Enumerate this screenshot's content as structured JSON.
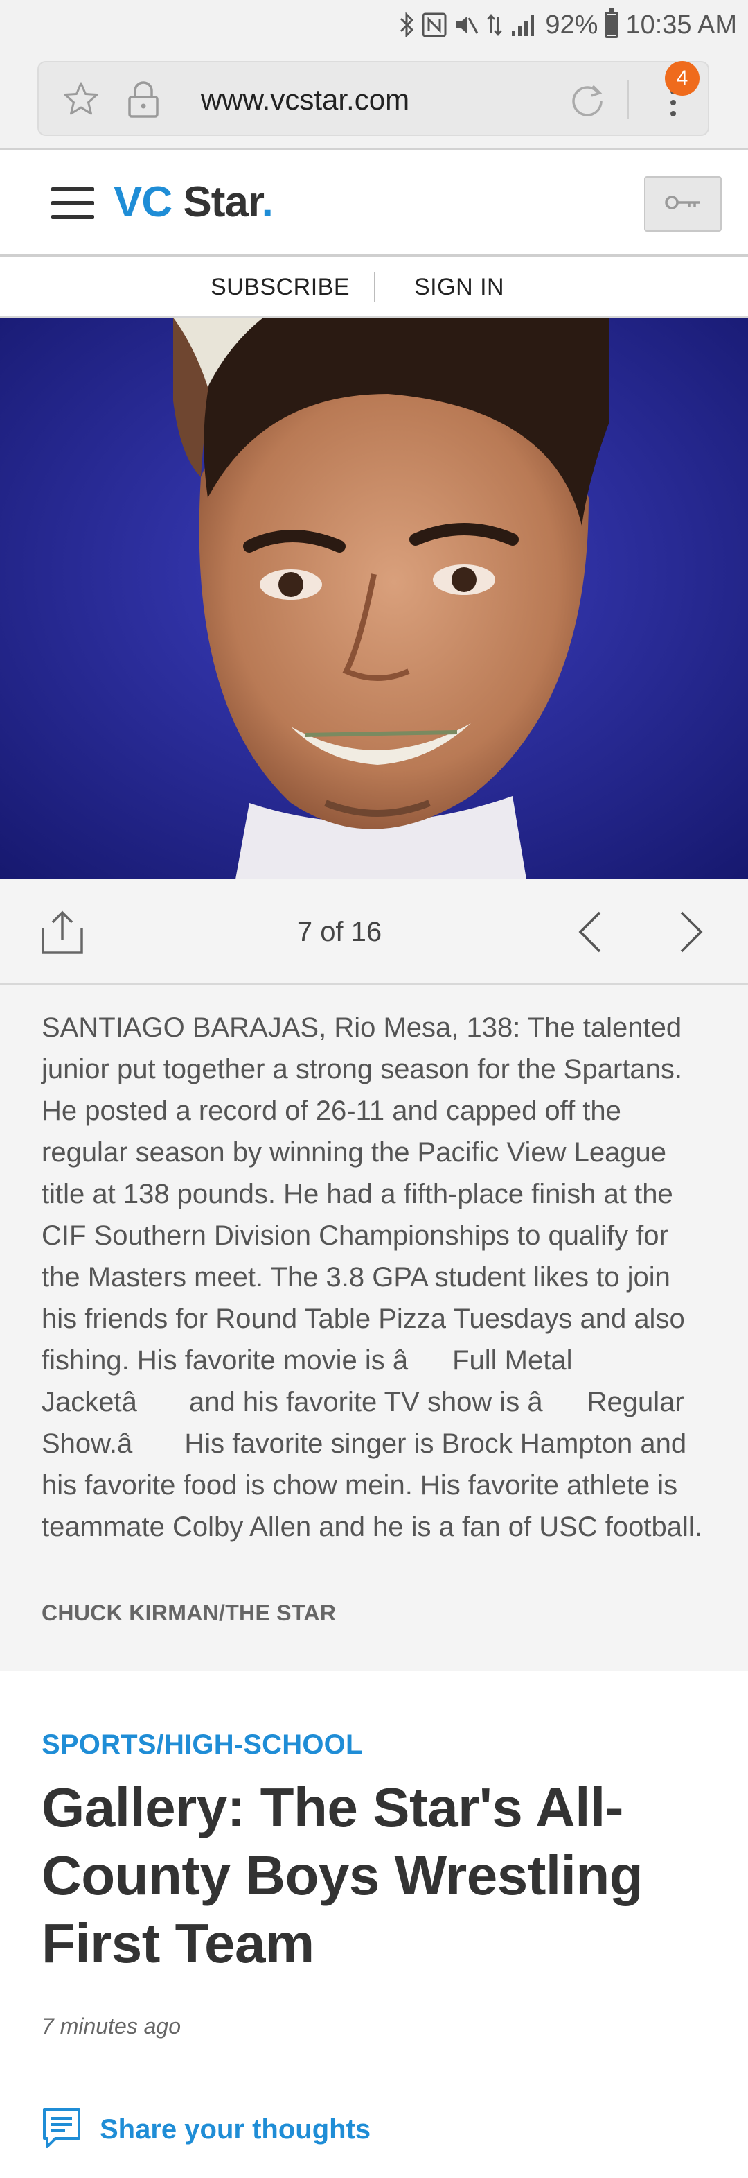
{
  "status_bar": {
    "battery": "92%",
    "time": "10:35 AM",
    "battery_level": 0.92
  },
  "browser": {
    "url": "www.vcstar.com",
    "tab_count": "4"
  },
  "header": {
    "logo_vc": "VC",
    "logo_star": "Star",
    "logo_dot": ".",
    "brand_color": "#1f8dd6"
  },
  "nav": {
    "subscribe": "SUBSCRIBE",
    "sign_in": "SIGN IN"
  },
  "gallery": {
    "counter": "7 of 16",
    "caption": "SANTIAGO BARAJAS, Rio Mesa, 138: The talented junior put together a strong season for the Spartans. He posted a record of 26-11 and capped off the regular season by winning the Pacific View League title at 138 pounds. He had a fifth-place finish at the CIF Southern Division Championships to qualify for the Masters meet. The 3.8 GPA student likes to join his friends for Round Table Pizza Tuesdays and also fishing. His favorite movie is âFull Metal Jacketâ and his favorite TV show is âRegular Show.â His favorite singer is Brock Hampton and his favorite food is chow mein. His favorite athlete is teammate Colby Allen and he is a fan of USC football.",
    "credit": "CHUCK KIRMAN/THE STAR"
  },
  "article": {
    "section": "SPORTS/HIGH-SCHOOL",
    "headline": "Gallery: The Star's All-County Boys Wrestling First Team",
    "timestamp": "7 minutes ago",
    "share_label": "Share your thoughts"
  }
}
